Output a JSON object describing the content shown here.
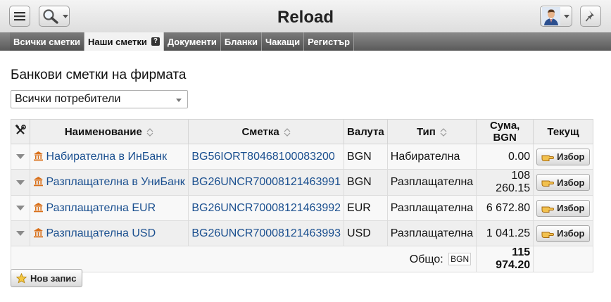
{
  "header": {
    "title": "Reload",
    "menu_icon": "hamburger-menu-icon",
    "search_icon": "magnifier-icon",
    "avatar_icon": "user-avatar-icon",
    "pin_icon": "pushpin-icon"
  },
  "tabs": [
    {
      "label": "Всички сметки",
      "active": false
    },
    {
      "label": "Наши сметки",
      "active": true,
      "badge": "?"
    },
    {
      "label": "Документи",
      "active": false
    },
    {
      "label": "Бланки",
      "active": false
    },
    {
      "label": "Чакащи",
      "active": false
    },
    {
      "label": "Регистър",
      "active": false
    }
  ],
  "main": {
    "title": "Банкови сметки на фирмата",
    "user_filter": {
      "selected": "Всички потребители"
    }
  },
  "table": {
    "columns": {
      "tools_icon": "tools-icon",
      "name": "Наименование",
      "account": "Сметка",
      "currency": "Валута",
      "type": "Тип",
      "amount": "Сума, BGN",
      "current": "Текущ"
    },
    "rows": [
      {
        "name": "Набирателна в ИнБанк",
        "iban": "BG56IORT80468100083200",
        "currency": "BGN",
        "type": "Набирателна",
        "amount": "0.00",
        "action": "Избор"
      },
      {
        "name": "Разплащателна в УниБанк",
        "iban": "BG26UNCR70008121463991",
        "currency": "BGN",
        "type": "Разплащателна",
        "amount": "108 260.15",
        "action": "Избор"
      },
      {
        "name": "Разплащателна EUR",
        "iban": "BG26UNCR70008121463992",
        "currency": "EUR",
        "type": "Разплащателна",
        "amount": "6 672.80",
        "action": "Избор"
      },
      {
        "name": "Разплащателна USD",
        "iban": "BG26UNCR70008121463993",
        "currency": "USD",
        "type": "Разплащателна",
        "amount": "1 041.25",
        "action": "Избор"
      }
    ],
    "total": {
      "label": "Общо:",
      "currency": "BGN",
      "value": "115 974.20"
    }
  },
  "new_record": {
    "label": "Нов запис",
    "icon": "star-icon"
  },
  "colors": {
    "link": "#1a4f8f",
    "bank_icon": "#d9701a"
  }
}
